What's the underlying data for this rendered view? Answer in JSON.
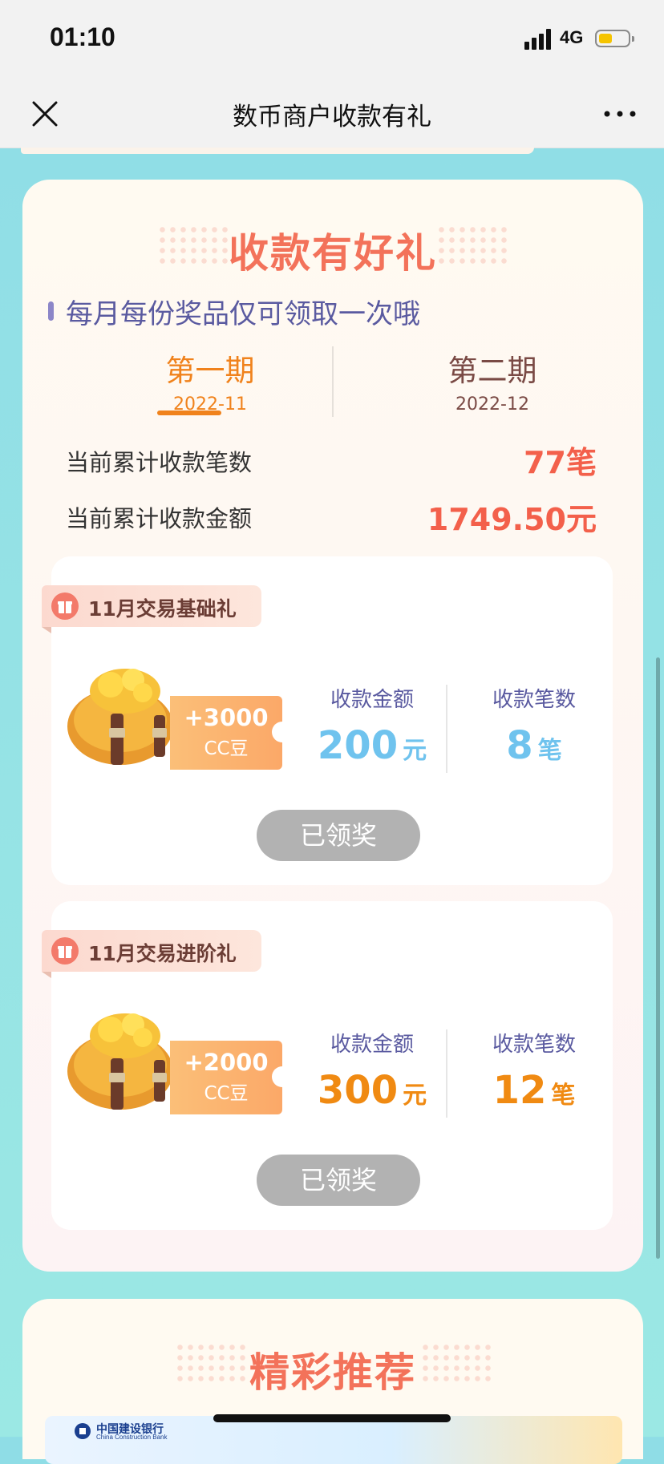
{
  "status_bar": {
    "time": "01:10",
    "network": "4G"
  },
  "nav": {
    "title": "数币商户收款有礼"
  },
  "main": {
    "section_title": "收款有好礼",
    "notice": "每月每份奖品仅可领取一次哦",
    "periods": [
      {
        "name": "第一期",
        "date": "2022-11",
        "active": true
      },
      {
        "name": "第二期",
        "date": "2022-12",
        "active": false
      }
    ],
    "stats": [
      {
        "label": "当前累计收款笔数",
        "value": "77笔"
      },
      {
        "label": "当前累计收款金额",
        "value": "1749.50元"
      }
    ],
    "rewards": [
      {
        "tag": "11月交易基础礼",
        "cc_amount": "+3000",
        "cc_unit": "CC豆",
        "amount_label": "收款金额",
        "amount_value": "200",
        "amount_unit": "元",
        "count_label": "收款笔数",
        "count_value": "8",
        "count_unit": "笔",
        "value_color": "#6fc3ee",
        "button": "已领奖"
      },
      {
        "tag": "11月交易进阶礼",
        "cc_amount": "+2000",
        "cc_unit": "CC豆",
        "amount_label": "收款金额",
        "amount_value": "300",
        "amount_unit": "元",
        "count_label": "收款笔数",
        "count_value": "12",
        "count_unit": "笔",
        "value_color": "#f08a12",
        "button": "已领奖"
      }
    ]
  },
  "recommend": {
    "title": "精彩推荐",
    "bank_name": "中国建设银行",
    "bank_en": "China Construction Bank"
  },
  "icons": {
    "close": "close-icon",
    "more": "more-icon",
    "gift": "gift-icon",
    "bag": "coin-bag-icon",
    "signal": "signal-icon",
    "battery": "battery-icon"
  }
}
